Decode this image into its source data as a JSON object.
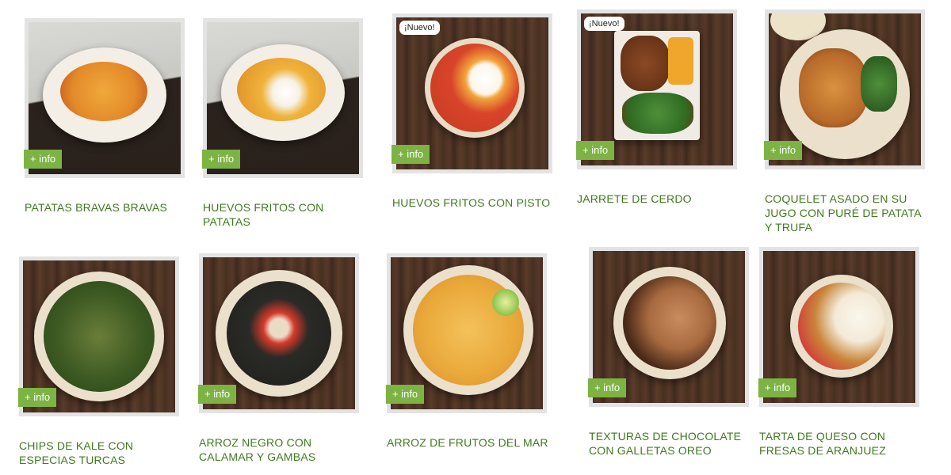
{
  "info_label": "+ info",
  "new_badge": "¡Nuevo!",
  "items": [
    {
      "title": "PATATAS BRAVAS BRAVAS"
    },
    {
      "title": "HUEVOS FRITOS CON PATATAS"
    },
    {
      "title": "HUEVOS FRITOS CON PISTO"
    },
    {
      "title": "JARRETE DE CERDO"
    },
    {
      "title": "COQUELET ASADO EN SU JUGO CON PURÉ DE PATATA Y TRUFA"
    },
    {
      "title": "CHIPS DE KALE CON ESPECIAS TURCAS"
    },
    {
      "title": "ARROZ NEGRO CON CALAMAR Y GAMBAS"
    },
    {
      "title": "ARROZ DE FRUTOS DEL MAR"
    },
    {
      "title": "TEXTURAS DE CHOCOLATE CON GALLETAS OREO"
    },
    {
      "title": "TARTA DE QUESO CON FRESAS DE ARANJUEZ"
    }
  ],
  "colors": {
    "accent": "#7cb342",
    "title": "#3f7a1e"
  }
}
